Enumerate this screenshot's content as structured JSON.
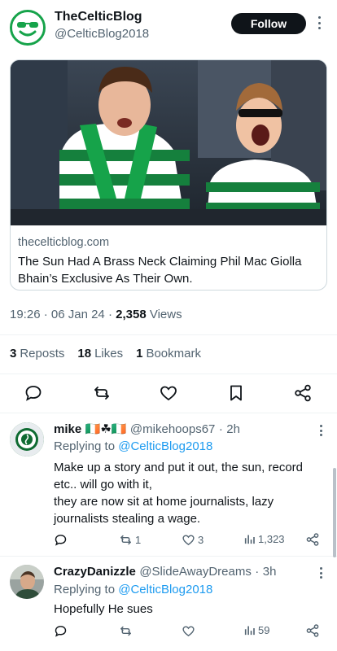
{
  "tweet": {
    "display_name": "TheCelticBlog",
    "handle": "@CelticBlog2018",
    "follow_label": "Follow",
    "card": {
      "domain": "thecelticblog.com",
      "title": "The Sun Had A Brass Neck Claiming Phil Mac Giolla Bhain’s Exclusive As Their Own."
    },
    "time": "19:26",
    "date": "06 Jan 24",
    "views_count": "2,358",
    "views_label": "Views",
    "reposts_count": "3",
    "reposts_label": "Reposts",
    "likes_count": "18",
    "likes_label": "Likes",
    "bookmarks_count": "1",
    "bookmarks_label": "Bookmark",
    "actions": [
      "reply-icon",
      "repost-icon",
      "like-icon",
      "bookmark-icon",
      "share-icon"
    ]
  },
  "replies": [
    {
      "name": "mike",
      "name_emoji": "🇮🇪☘🇮🇪",
      "handle": "@mikehoops67",
      "time": "2h",
      "replying_prefix": "Replying to",
      "replying_to": "@CelticBlog2018",
      "text": "Make up a story and put it out, the sun, record etc.. will go with it,\nthey are now sit at home journalists, lazy journalists stealing a wage.",
      "reposts": "1",
      "likes": "3",
      "views": "1,323"
    },
    {
      "name": "CrazyDanizzle",
      "handle": "@SlideAwayDreams",
      "time": "3h",
      "replying_prefix": "Replying to",
      "replying_to": "@CelticBlog2018",
      "text": "Hopefully He sues",
      "views": "59"
    }
  ],
  "colors": {
    "accent": "#1d9bf0",
    "celtic_green": "#16a34a",
    "text": "#0f1419",
    "muted": "#536471"
  }
}
